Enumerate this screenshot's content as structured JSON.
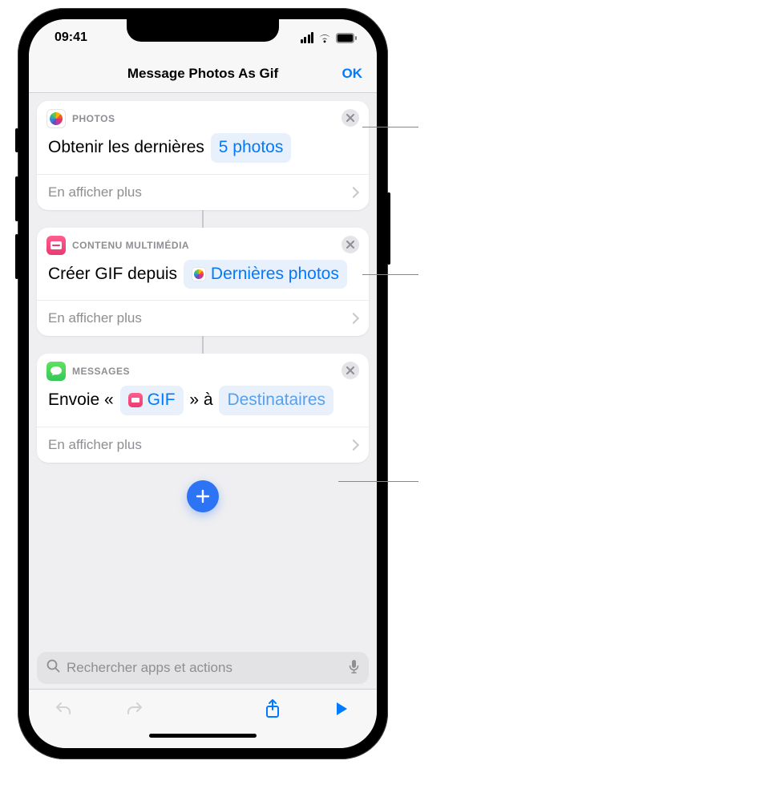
{
  "status": {
    "time": "09:41"
  },
  "nav": {
    "title": "Message Photos As Gif",
    "ok": "OK"
  },
  "actions": [
    {
      "app_label": "PHOTOS",
      "close": "×",
      "segments": [
        {
          "kind": "text",
          "value": "Obtenir les dernières "
        },
        {
          "kind": "token",
          "label": "5 photos"
        }
      ],
      "show_more": "En afficher plus"
    },
    {
      "app_label": "CONTENU MULTIMÉDIA",
      "close": "×",
      "segments": [
        {
          "kind": "text",
          "value": "Créer GIF depuis "
        },
        {
          "kind": "token",
          "icon": "photos",
          "label": "Dernières photos"
        }
      ],
      "show_more": "En afficher plus"
    },
    {
      "app_label": "MESSAGES",
      "close": "×",
      "segments": [
        {
          "kind": "text",
          "value": "Envoie « "
        },
        {
          "kind": "token",
          "icon": "media",
          "label": "GIF"
        },
        {
          "kind": "text",
          "value": " » à "
        },
        {
          "kind": "token",
          "faded": true,
          "label": "Destinataires"
        }
      ],
      "show_more": "En afficher plus"
    }
  ],
  "search": {
    "placeholder": "Rechercher apps et actions"
  }
}
